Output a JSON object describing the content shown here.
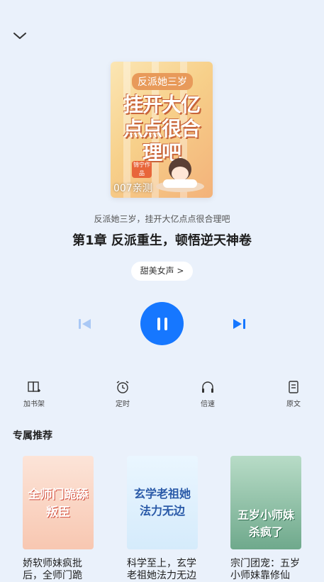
{
  "cover": {
    "tag_text": "反派她三岁",
    "title_art": "挂开大亿点点很合理吧",
    "seal_text": "锦宁作品",
    "narrator_name": "007亲测"
  },
  "book_title": "反派她三岁，挂开大亿点点很合理吧",
  "chapter_title": "第1章 反派重生，顿悟逆天神卷",
  "voice_label": "甜美女声 >",
  "tools": [
    {
      "label": "加书架",
      "icon": "bookshelf-add-icon"
    },
    {
      "label": "定时",
      "icon": "alarm-icon"
    },
    {
      "label": "倍速",
      "icon": "headphones-icon"
    },
    {
      "label": "原文",
      "icon": "document-icon"
    }
  ],
  "recommend": {
    "title": "专属推荐",
    "items": [
      {
        "name": "娇软师妹疯批后，全师门跪",
        "cover_text": "全师门跪舔叛臣"
      },
      {
        "name": "科学至上，玄学老祖她法力无边",
        "cover_text": "玄学老祖她法力无边"
      },
      {
        "name": "宗门团宠：五岁小师妹靠修仙",
        "cover_text": "五岁小师妹杀疯了"
      }
    ]
  },
  "colors": {
    "accent": "#1677ff",
    "background": "#eaf1fb"
  }
}
